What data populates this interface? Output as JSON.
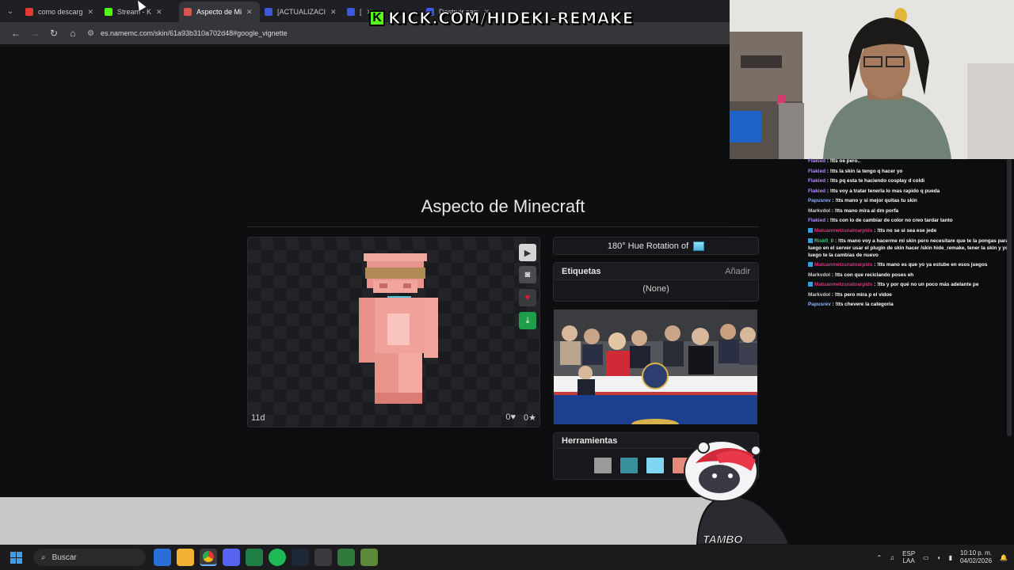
{
  "browser": {
    "tabs": [
      {
        "title": "como descarg",
        "favicon_color": "#e53935",
        "active": false
      },
      {
        "title": "Stream - K",
        "favicon_color": "#53fc18",
        "active": false
      },
      {
        "title": "Aspecto de Mi",
        "favicon_color": "#d9534f",
        "active": true
      },
      {
        "title": "[ACTUALIZACI",
        "favicon_color": "#3b5bdb",
        "active": false
      },
      {
        "title": "[",
        "favicon_color": "#3b5bdb",
        "active": false
      },
      {
        "title": "Destruir sandb",
        "favicon_color": "#3b5bdb",
        "active": false
      }
    ],
    "url": "es.namemc.com/skin/61a93b310a702d48#google_vignette"
  },
  "stream_banner": {
    "logo_letter": "K",
    "text": "KICK.COM/HIDEKI-REMAKE"
  },
  "page": {
    "title": "Aspecto de Minecraft",
    "viewer": {
      "age": "11d",
      "likes": "0♥",
      "stars": "0★"
    },
    "rotation_label": "180° Hue Rotation of",
    "tags": {
      "heading": "Etiquetas",
      "add_label": "Añadir",
      "empty_text": "(None)"
    },
    "tools": {
      "heading": "Herramientas",
      "colors": [
        "#9a9a9a",
        "#3a8f9c",
        "#7fd4f0",
        "#e58a7a"
      ]
    }
  },
  "mascot": {
    "label": "TAMBO"
  },
  "chat": [
    {
      "user": "Flakied",
      "color": "#b58cff",
      "text": "!tts oe pero.."
    },
    {
      "user": "Flakied",
      "color": "#b58cff",
      "text": "!tts la skin la tengo q hacer yo"
    },
    {
      "user": "Flakied",
      "color": "#b58cff",
      "text": "!tts pq esta te haciendo cosplay d coldi"
    },
    {
      "user": "Flakied",
      "color": "#b58cff",
      "text": "!tts voy a tratar tenerla lo mas rapido q pueda"
    },
    {
      "user": "Papusrev",
      "color": "#8fb4ff",
      "text": "!tts mano y si mejor quitas tu skin"
    },
    {
      "user": "Markvdol",
      "color": "#cfcfcf",
      "text": "!tts mano mira al dm porfa"
    },
    {
      "user": "Flakied",
      "color": "#b58cff",
      "text": "!tts con lo de cambiar de color no creo tardar tanto"
    },
    {
      "user": "Matuanmetzunatoarpids",
      "color": "#e0307a",
      "text": "!tts no se si sea ese jede"
    },
    {
      "user": "Risk0_0",
      "color": "#3fd47e",
      "text": "!tts mano voy a hacerme mi skin pero necesitare que te la pongas para luego en el server usar el plugin de skin hacer /skin hide_remake, tener la skin y yo luego te la cambias de nuevo"
    },
    {
      "user": "Matuanmetzunatoarpids",
      "color": "#e0307a",
      "text": "!tts mano es que yo ya estube en esos juegos"
    },
    {
      "user": "Markvdol",
      "color": "#cfcfcf",
      "text": "!tts con que reciclando poses eh"
    },
    {
      "user": "Matuanmetzunatoarpids",
      "color": "#e0307a",
      "text": "!tts y por qué no un poco más adelante pe"
    },
    {
      "user": "Markvdol",
      "color": "#cfcfcf",
      "text": "!tts pero mira p el vidoe"
    },
    {
      "user": "Papusrev",
      "color": "#8fb4ff",
      "text": "!tts chevere la categoria"
    }
  ],
  "taskbar": {
    "search_placeholder": "Buscar",
    "lang_line1": "ESP",
    "lang_line2": "LAA",
    "time": "10:10 p. m.",
    "date": "04/02/2026"
  }
}
